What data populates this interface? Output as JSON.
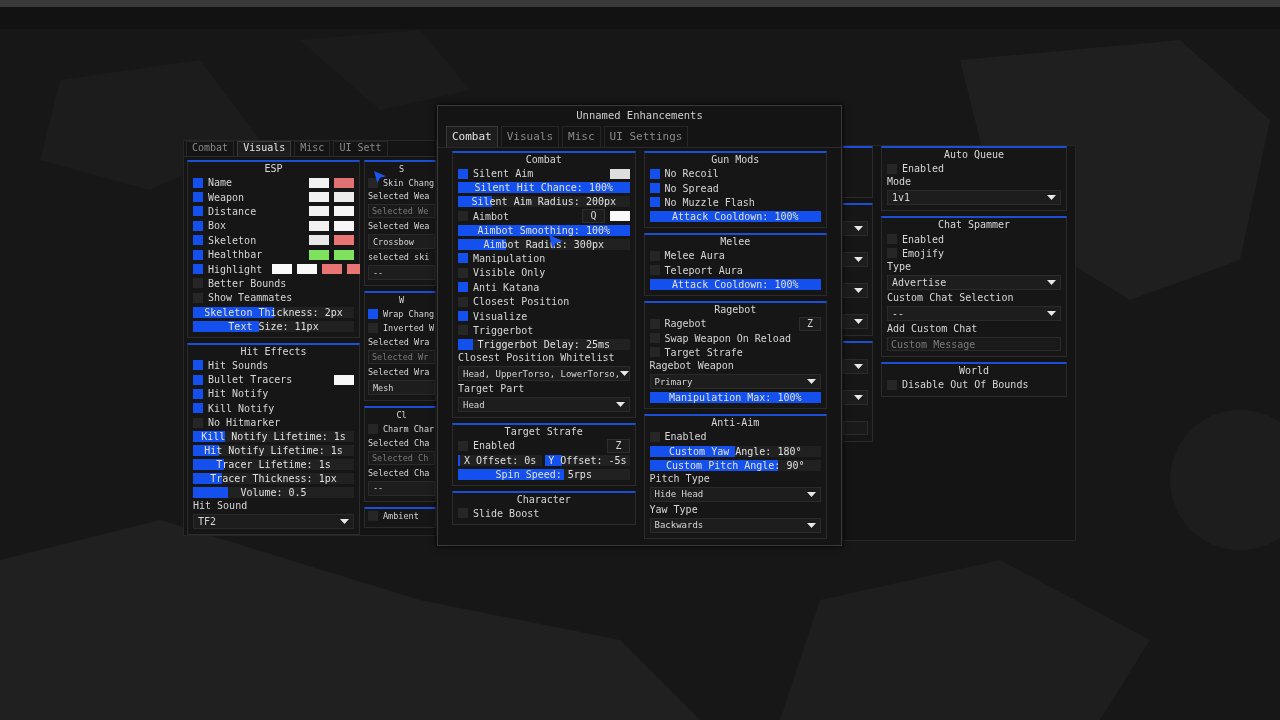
{
  "left_window": {
    "tabs": [
      {
        "label": "Combat",
        "selected": false
      },
      {
        "label": "Visuals",
        "selected": true
      },
      {
        "label": "Misc",
        "selected": false
      },
      {
        "label": "UI Sett",
        "selected": false
      }
    ],
    "columns": [
      [
        {
          "title": "ESP",
          "items": [
            {
              "kind": "toggle",
              "label": "Name",
              "checked": true,
              "swatches": [
                {
                  "color": "#f2f2f2"
                },
                {
                  "color": "#e07272"
                }
              ]
            },
            {
              "kind": "toggle",
              "label": "Weapon",
              "checked": true,
              "swatches": [
                {
                  "color": "#f2f2f2"
                },
                {
                  "color": "#ececec"
                }
              ]
            },
            {
              "kind": "toggle",
              "label": "Distance",
              "checked": true,
              "swatches": [
                {
                  "color": "#f2f2f2"
                },
                {
                  "color": "#f6f6f6"
                }
              ]
            },
            {
              "kind": "toggle",
              "label": "Box",
              "checked": true,
              "swatches": [
                {
                  "color": "#f2f2f2"
                },
                {
                  "color": "#f6f6f6"
                }
              ]
            },
            {
              "kind": "toggle",
              "label": "Skeleton",
              "checked": true,
              "swatches": [
                {
                  "color": "#e8e8e8"
                },
                {
                  "color": "#e87474"
                }
              ]
            },
            {
              "kind": "toggle",
              "label": "Healthbar",
              "checked": true,
              "swatches": [
                {
                  "color": "#7fe25e"
                },
                {
                  "color": "#7fe25e"
                }
              ]
            },
            {
              "kind": "toggle",
              "label": "Highlight",
              "checked": true,
              "swatches": [
                {
                  "color": "#fafafa"
                },
                {
                  "color": "#f8f8f8"
                },
                {
                  "color": "#e87474"
                },
                {
                  "color": "#e87474"
                }
              ]
            },
            {
              "kind": "toggle",
              "label": "Better Bounds",
              "checked": false
            },
            {
              "kind": "toggle",
              "label": "Show Teammates",
              "checked": false
            },
            {
              "kind": "slider",
              "label": "Skeleton Thickness: 2px",
              "level": 0.5
            },
            {
              "kind": "slider",
              "label": "Text Size: 11px",
              "level": 0.41
            }
          ]
        },
        {
          "title": "Hit Effects",
          "items": [
            {
              "kind": "toggle",
              "label": "Hit Sounds",
              "checked": true
            },
            {
              "kind": "toggle",
              "label": "Bullet Tracers",
              "checked": true,
              "swatches": [
                {
                  "color": "#f8f8f8"
                }
              ]
            },
            {
              "kind": "toggle",
              "label": "Hit Notify",
              "checked": true
            },
            {
              "kind": "toggle",
              "label": "Kill Notify",
              "checked": true
            },
            {
              "kind": "toggle",
              "label": "No Hitmarker",
              "checked": false
            },
            {
              "kind": "slider",
              "label": "Kill Notify Lifetime: 1s",
              "level": 0.2
            },
            {
              "kind": "slider",
              "label": "Hit Notify Lifetime: 1s",
              "level": 0.16
            },
            {
              "kind": "slider",
              "label": "Tracer Lifetime: 1s",
              "level": 0.19
            },
            {
              "kind": "slider",
              "label": "Tracer Thickness: 1px",
              "level": 0.18
            },
            {
              "kind": "slider",
              "label": "Volume: 0.5",
              "level": 0.22
            },
            {
              "kind": "label",
              "text": "Hit Sound"
            },
            {
              "kind": "dropdown",
              "value": "TF2"
            }
          ]
        }
      ],
      [
        {
          "title": "S",
          "items": [
            {
              "kind": "toggle",
              "label": "Skin Chang",
              "checked": false
            },
            {
              "kind": "label",
              "text": "Selected Wea"
            },
            {
              "kind": "field",
              "placeholder": "Selected We"
            },
            {
              "kind": "label",
              "text": "Selected Wea"
            },
            {
              "kind": "dropdown",
              "value": "Crossbow"
            },
            {
              "kind": "label",
              "text": "selected ski"
            },
            {
              "kind": "dropdown",
              "value": "--"
            }
          ]
        },
        {
          "title": "W",
          "items": [
            {
              "kind": "toggle",
              "label": "Wrap Chang",
              "checked": true
            },
            {
              "kind": "toggle",
              "label": "Inverted W",
              "checked": false
            },
            {
              "kind": "label",
              "text": "Selected Wra"
            },
            {
              "kind": "field",
              "placeholder": "Selected Wr"
            },
            {
              "kind": "label",
              "text": "Selected Wra"
            },
            {
              "kind": "dropdown",
              "value": "Mesh"
            }
          ]
        },
        {
          "title": "Cl",
          "items": [
            {
              "kind": "toggle",
              "label": "Charm Char",
              "checked": false
            },
            {
              "kind": "label",
              "text": "Selected Cha"
            },
            {
              "kind": "field",
              "placeholder": "Selected Ch"
            },
            {
              "kind": "label",
              "text": "Selected Cha"
            },
            {
              "kind": "dropdown",
              "value": "--"
            }
          ]
        },
        {
          "items": [
            {
              "kind": "toggle",
              "label": "Ambient",
              "checked": false
            }
          ]
        }
      ]
    ]
  },
  "main_window": {
    "title": "Unnamed Enhancements",
    "tabs": [
      {
        "label": "Combat",
        "selected": true
      },
      {
        "label": "Visuals",
        "selected": false
      },
      {
        "label": "Misc",
        "selected": false
      },
      {
        "label": "UI Settings",
        "selected": false
      }
    ],
    "columns": [
      [
        {
          "title": "Combat",
          "items": [
            {
              "kind": "toggle",
              "label": "Silent Aim",
              "checked": true,
              "swatches": [
                {
                  "color": "#dedede"
                }
              ]
            },
            {
              "kind": "slider",
              "label": "Silent Hit Chance: 100%",
              "level": 1
            },
            {
              "kind": "slider",
              "label": "Silent Aim Radius: 200px",
              "level": 0.2
            },
            {
              "kind": "toggle",
              "label": "Aimbot",
              "checked": false,
              "key": "Q",
              "swatches": [
                {
                  "color": "#fafafa"
                }
              ]
            },
            {
              "kind": "slider",
              "label": "Aimbot Smoothing: 100%",
              "level": 1
            },
            {
              "kind": "slider",
              "label": "Aimbot Radius: 300px",
              "level": 0.28
            },
            {
              "kind": "toggle",
              "label": "Manipulation",
              "checked": true
            },
            {
              "kind": "toggle",
              "label": "Visible Only",
              "checked": false
            },
            {
              "kind": "toggle",
              "label": "Anti Katana",
              "checked": true
            },
            {
              "kind": "toggle",
              "label": "Closest Position",
              "checked": false
            },
            {
              "kind": "toggle",
              "label": "Visualize",
              "checked": true
            },
            {
              "kind": "toggle",
              "label": "Triggerbot",
              "checked": false
            },
            {
              "kind": "slider",
              "label": "Triggerbot Delay: 25ms",
              "level": 0.09
            },
            {
              "kind": "label",
              "text": "Closest Position Whitelist"
            },
            {
              "kind": "dropdown",
              "value": "Head, UpperTorso, LowerTorso,"
            },
            {
              "kind": "label",
              "text": "Target Part"
            },
            {
              "kind": "dropdown",
              "value": "Head"
            }
          ]
        },
        {
          "title": "Target Strafe",
          "items": [
            {
              "kind": "toggle",
              "label": "Enabled",
              "checked": false,
              "key": "Z"
            },
            {
              "kind": "double_slider",
              "sliders": [
                {
                  "label": "X Offset: 0s",
                  "level": 0.02
                },
                {
                  "label": "Y Offset: -5s",
                  "level": 0.2
                }
              ]
            },
            {
              "kind": "slider",
              "label": "Spin Speed: 5rps",
              "level": 0.62
            }
          ]
        },
        {
          "title": "Character",
          "items": [
            {
              "kind": "toggle",
              "label": "Slide Boost",
              "checked": false
            }
          ]
        }
      ],
      [
        {
          "title": "Gun Mods",
          "items": [
            {
              "kind": "toggle",
              "label": "No Recoil",
              "checked": true
            },
            {
              "kind": "toggle",
              "label": "No Spread",
              "checked": true
            },
            {
              "kind": "toggle",
              "label": "No Muzzle Flash",
              "checked": true
            },
            {
              "kind": "slider",
              "label": "Attack Cooldown: 100%",
              "level": 1
            }
          ]
        },
        {
          "title": "Melee",
          "items": [
            {
              "kind": "toggle",
              "label": "Melee Aura",
              "checked": false
            },
            {
              "kind": "toggle",
              "label": "Teleport Aura",
              "checked": false
            },
            {
              "kind": "slider",
              "label": "Attack Cooldown: 100%",
              "level": 1
            }
          ]
        },
        {
          "title": "Ragebot",
          "items": [
            {
              "kind": "toggle",
              "label": "Ragebot",
              "checked": false,
              "key": "Z"
            },
            {
              "kind": "toggle",
              "label": "Swap Weapon On Reload",
              "checked": false
            },
            {
              "kind": "toggle",
              "label": "Target Strafe",
              "checked": false
            },
            {
              "kind": "label",
              "text": "Ragebot Weapon"
            },
            {
              "kind": "dropdown",
              "value": "Primary"
            },
            {
              "kind": "slider",
              "label": "Manipulation Max: 100%",
              "level": 1
            }
          ]
        },
        {
          "title": "Anti-Aim",
          "items": [
            {
              "kind": "toggle",
              "label": "Enabled",
              "checked": false
            },
            {
              "kind": "slider",
              "label": "Custom Yaw Angle: 180°",
              "level": 0.5
            },
            {
              "kind": "slider",
              "label": "Custom Pitch Angle: 90°",
              "level": 0.75
            },
            {
              "kind": "label",
              "text": "Pitch Type"
            },
            {
              "kind": "dropdown",
              "value": "Hide Head"
            },
            {
              "kind": "label",
              "text": "Yaw Type"
            },
            {
              "kind": "dropdown",
              "value": "Backwards"
            }
          ]
        }
      ]
    ]
  },
  "right_window": {
    "columns": [
      [
        {},
        {
          "items": [
            {
              "kind": "dropdown"
            },
            {
              "kind": "dropdown"
            },
            {
              "kind": "dropdown"
            },
            {
              "kind": "dropdown"
            }
          ]
        },
        {
          "items": [
            {
              "kind": "dropdown"
            },
            {
              "kind": "dropdown"
            },
            {
              "kind": "field"
            }
          ]
        }
      ],
      [
        {
          "title": "Auto Queue",
          "items": [
            {
              "kind": "toggle",
              "label": "Enabled",
              "checked": false
            },
            {
              "kind": "label",
              "text": "Mode"
            },
            {
              "kind": "dropdown",
              "value": "1v1"
            }
          ]
        },
        {
          "title": "Chat Spammer",
          "items": [
            {
              "kind": "toggle",
              "label": "Enabled",
              "checked": false
            },
            {
              "kind": "toggle",
              "label": "Emojify",
              "checked": false
            },
            {
              "kind": "label",
              "text": "Type"
            },
            {
              "kind": "dropdown",
              "value": "Advertise"
            },
            {
              "kind": "label",
              "text": "Custom Chat Selection"
            },
            {
              "kind": "dropdown",
              "value": "--"
            },
            {
              "kind": "label",
              "text": "Add Custom Chat"
            },
            {
              "kind": "field",
              "placeholder": "Custom Message"
            }
          ]
        },
        {
          "title": "World",
          "items": [
            {
              "kind": "toggle",
              "label": "Disable Out Of Bounds",
              "checked": false
            }
          ]
        }
      ]
    ]
  }
}
